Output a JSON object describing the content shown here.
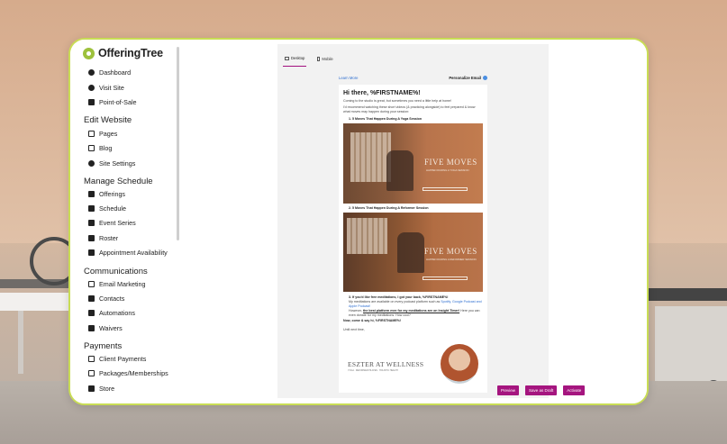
{
  "app": {
    "logo_text": "OfferingTree"
  },
  "sidebar": {
    "items_top": [
      {
        "label": "Dashboard",
        "icon": "gauge-icon"
      },
      {
        "label": "Visit Site",
        "icon": "globe-icon"
      },
      {
        "label": "Point-of-Sale",
        "icon": "register-icon"
      }
    ],
    "edit_website": {
      "title": "Edit Website",
      "items": [
        {
          "label": "Pages",
          "icon": "pages-icon"
        },
        {
          "label": "Blog",
          "icon": "blog-icon"
        },
        {
          "label": "Site Settings",
          "icon": "gear-icon"
        }
      ]
    },
    "manage_schedule": {
      "title": "Manage Schedule",
      "items": [
        {
          "label": "Offerings",
          "icon": "star-icon"
        },
        {
          "label": "Schedule",
          "icon": "calendar-icon"
        },
        {
          "label": "Event Series",
          "icon": "list-icon"
        },
        {
          "label": "Roster",
          "icon": "roster-icon"
        },
        {
          "label": "Appointment Availability",
          "icon": "people-icon"
        }
      ]
    },
    "communications": {
      "title": "Communications",
      "items": [
        {
          "label": "Email Marketing",
          "icon": "envelope-icon"
        },
        {
          "label": "Contacts",
          "icon": "contacts-icon"
        },
        {
          "label": "Automations",
          "icon": "wand-icon"
        },
        {
          "label": "Waivers",
          "icon": "document-icon"
        }
      ]
    },
    "payments": {
      "title": "Payments",
      "items": [
        {
          "label": "Client Payments",
          "icon": "card-icon"
        },
        {
          "label": "Packages/Memberships",
          "icon": "package-icon"
        },
        {
          "label": "Store",
          "icon": "store-icon"
        }
      ]
    }
  },
  "editor": {
    "tabs": [
      {
        "label": "Desktop",
        "active": true
      },
      {
        "label": "Mobile",
        "active": false
      }
    ],
    "learn_more": "Learn More",
    "personalize": "Personalize Email"
  },
  "email": {
    "greeting": "Hi there, %FIRSTNAME%!",
    "intro1": "Coming to the studio is great, but sometimes you need a little help at home!",
    "intro2": "I'd recommend watching these short videos (& practicing alongside) to feel prepared & know what moves may happen during your session:",
    "item1": "1. 5 Moves That Happen During A Yoga Session",
    "item2": "2. 5 Moves That Happen During A Reformer Session",
    "img_title": "FIVE MOVES",
    "img1_sub": "HAPPEN DURING A YOGA SESSION",
    "img2_sub": "HAPPEN DURING A REFORMER SESSION",
    "item3_head": "3. If you'd like free meditations, I got your back, %FIRSTNAME%!",
    "item3_line1": "My meditations are available on every podcast platform such as",
    "item3_links": "Spotify, Google Podcast and Apple Podcast!",
    "item3_line2a": "However,",
    "item3_bold": "the best platform ever for my meditations are on Insight Timer!",
    "item3_line2b": "Here you can even donate for my meditations. How cool?",
    "closing": "Now, come & say hi, %FIRSTNAME%!",
    "signoff": "Until next time,",
    "brand": "ESZTER AT WELLNESS",
    "brand_tag": "YOGA · REFORMER PILATES · HOLISTIC HEALTH"
  },
  "actions": {
    "preview": "Preview",
    "save_draft": "Save as Draft",
    "activate": "Activate"
  },
  "colors": {
    "accent": "#a5157f",
    "brand_green": "#9dc13c",
    "frame_border": "#c9dd55"
  }
}
